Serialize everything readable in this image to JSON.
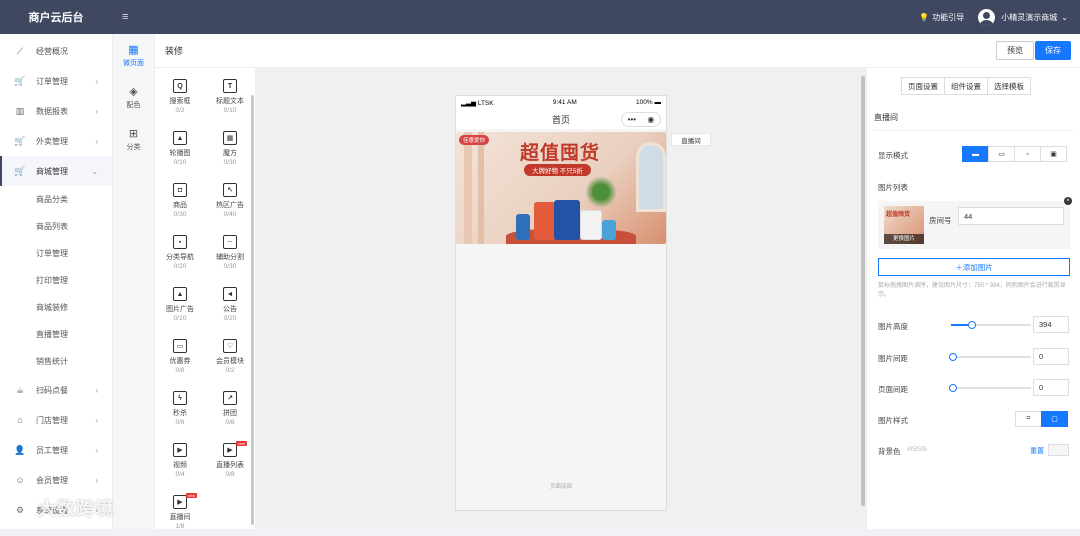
{
  "topbar": {
    "brand": "商户云后台",
    "guide": "功能引导",
    "user": "小精灵演示商城"
  },
  "sidebar": {
    "items": [
      {
        "label": "经营概况",
        "icon": "chart-line-icon"
      },
      {
        "label": "订单管理",
        "icon": "cart-icon"
      },
      {
        "label": "数据报表",
        "icon": "bar-chart-icon"
      },
      {
        "label": "外卖管理",
        "icon": "cart-icon"
      },
      {
        "label": "商城管理",
        "icon": "cart-icon"
      }
    ],
    "sub_items": [
      "商品分类",
      "商品列表",
      "订单管理",
      "打印管理",
      "商城装修",
      "直播管理",
      "销售统计"
    ],
    "items2": [
      {
        "label": "扫码点餐",
        "icon": "cup-icon"
      },
      {
        "label": "门店管理",
        "icon": "home-icon"
      },
      {
        "label": "员工管理",
        "icon": "user-icon"
      },
      {
        "label": "会员管理",
        "icon": "smile-icon"
      },
      {
        "label": "系统设置",
        "icon": "gear-icon"
      }
    ]
  },
  "categories": [
    {
      "label": "微页面",
      "icon": "grid-icon"
    },
    {
      "label": "配色",
      "icon": "paint-bucket-icon"
    },
    {
      "label": "分类",
      "icon": "category-icon"
    }
  ],
  "header": {
    "title": "装修",
    "preview": "预览",
    "save": "保存"
  },
  "components": [
    {
      "name": "搜索框",
      "count": "0/2",
      "glyph": "Q"
    },
    {
      "name": "标题文本",
      "count": "0/10",
      "glyph": "T"
    },
    {
      "name": "轮播图",
      "count": "0/10",
      "glyph": "▲"
    },
    {
      "name": "魔方",
      "count": "0/30",
      "glyph": "▦"
    },
    {
      "name": "商品",
      "count": "0/30",
      "glyph": "◘"
    },
    {
      "name": "热区广告",
      "count": "0/40",
      "glyph": "↖"
    },
    {
      "name": "分类导航",
      "count": "0/20",
      "glyph": "▪"
    },
    {
      "name": "辅助分割",
      "count": "0/30",
      "glyph": "┄"
    },
    {
      "name": "图片广告",
      "count": "0/10",
      "glyph": "▲"
    },
    {
      "name": "公告",
      "count": "0/20",
      "glyph": "◄"
    },
    {
      "name": "优惠券",
      "count": "0/8",
      "glyph": "▭"
    },
    {
      "name": "会员模块",
      "count": "0/2",
      "glyph": "♡"
    },
    {
      "name": "秒杀",
      "count": "0/8",
      "glyph": "ϟ"
    },
    {
      "name": "拼团",
      "count": "0/8",
      "glyph": "↗"
    },
    {
      "name": "视频",
      "count": "0/4",
      "glyph": "▶"
    },
    {
      "name": "直播列表",
      "count": "0/8",
      "glyph": "▶",
      "badge": "new"
    },
    {
      "name": "直播间",
      "count": "1/8",
      "glyph": "▶",
      "badge": "new"
    }
  ],
  "phone": {
    "carrier": "LTSK",
    "time": "9:41 AM",
    "battery": "100%",
    "nav_title": "首页",
    "capsule_dots": "•••",
    "capsule_circle": "◉",
    "banner": {
      "tag": "佳惠爱你",
      "headline": "超值囤货",
      "subline": "大牌好物 不只5折"
    },
    "footer": "页面底部"
  },
  "live_tag": "直播间",
  "settings": {
    "tabs": [
      "页面设置",
      "组件设置",
      "选择模板"
    ],
    "section": "直播间",
    "display_mode_label": "显示模式",
    "image_list_label": "图片列表",
    "card": {
      "thumb_title": "超值囤货",
      "change_label": "更换图片",
      "room_label": "房间号",
      "room_value": "44"
    },
    "add_image": "＋添加图片",
    "hint": "鼠标拖拽图片调序，建议图片尺寸：750 * 394，同则图片会进行裁剪显示。",
    "image_height_label": "图片高度",
    "image_height": "394",
    "image_gap_label": "图片间距",
    "image_gap": "0",
    "page_margin_label": "页面间距",
    "page_margin": "0",
    "image_style_label": "图片样式",
    "bg_label": "背景色",
    "bg_value": "#f5f5f5",
    "reset": "重置",
    "accent": "#1677ff"
  },
  "watermark": "大数跨境"
}
